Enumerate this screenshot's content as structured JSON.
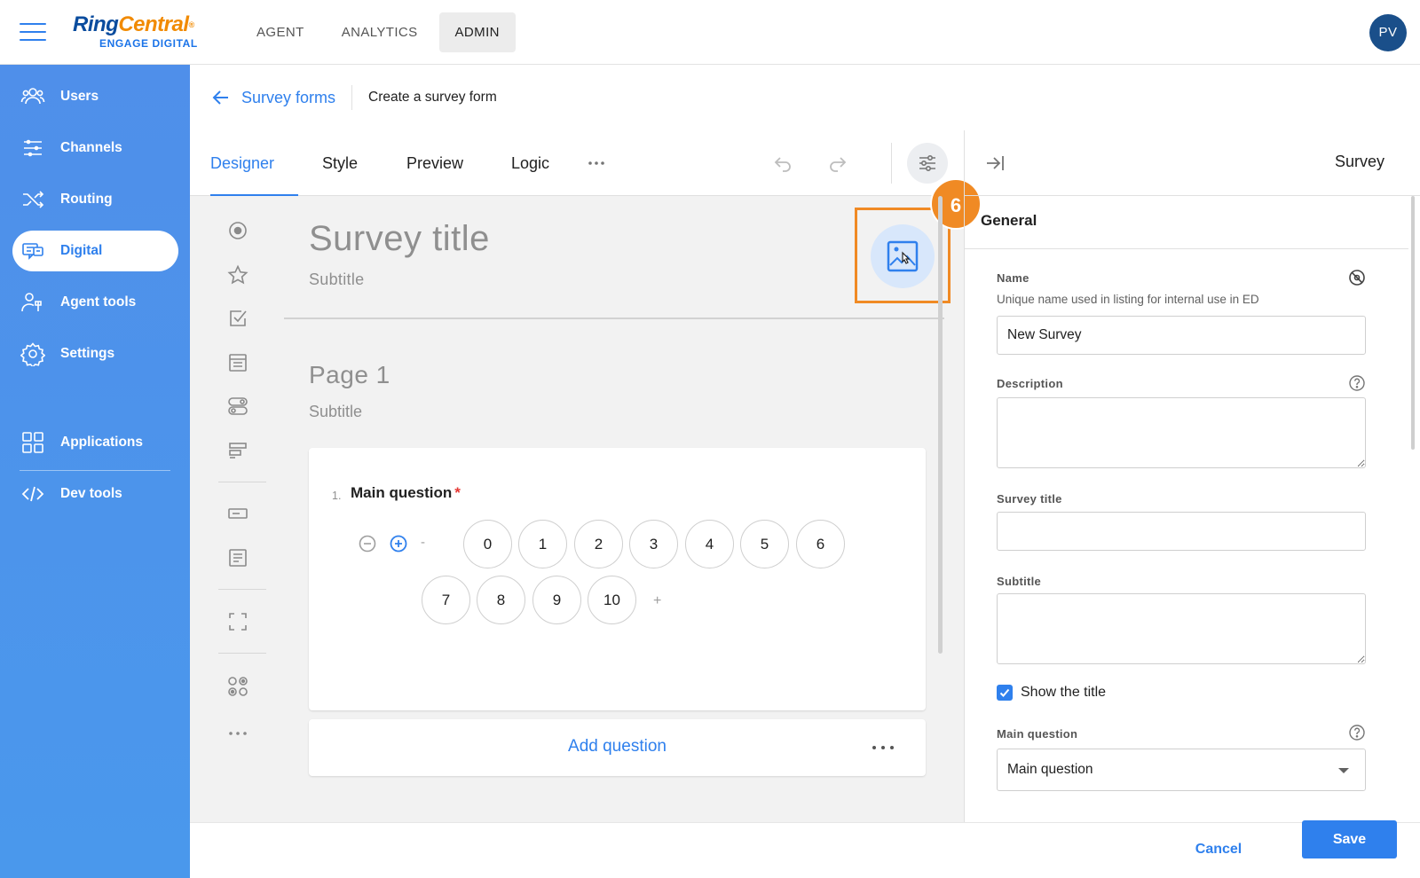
{
  "header": {
    "logo_brand_part1": "Ring",
    "logo_brand_part2": "Central",
    "logo_reg": "®",
    "logo_sub": "ENGAGE DIGITAL",
    "nav": [
      {
        "label": "AGENT",
        "active": false
      },
      {
        "label": "ANALYTICS",
        "active": false
      },
      {
        "label": "ADMIN",
        "active": true
      }
    ],
    "avatar_initials": "PV"
  },
  "sidebar": {
    "items": [
      {
        "label": "Users",
        "icon": "users-icon"
      },
      {
        "label": "Channels",
        "icon": "channels-icon"
      },
      {
        "label": "Routing",
        "icon": "routing-icon"
      },
      {
        "label": "Digital",
        "icon": "digital-icon",
        "active": true
      },
      {
        "label": "Agent tools",
        "icon": "agent-tools-icon"
      },
      {
        "label": "Settings",
        "icon": "gear-icon"
      },
      {
        "label": "Applications",
        "icon": "applications-icon"
      },
      {
        "label": "Dev tools",
        "icon": "code-icon"
      }
    ]
  },
  "breadcrumb": {
    "parent": "Survey forms",
    "current": "Create a survey form"
  },
  "tabs": [
    {
      "label": "Designer",
      "active": true
    },
    {
      "label": "Style"
    },
    {
      "label": "Preview"
    },
    {
      "label": "Logic"
    }
  ],
  "toolbar_icons": [
    "more-horizontal-icon",
    "undo-icon",
    "redo-icon",
    "settings-sliders-icon"
  ],
  "canvas": {
    "survey_title": "Survey title",
    "survey_subtitle": "Subtitle",
    "step_badge": "6",
    "page_title": "Page 1",
    "page_subtitle": "Subtitle",
    "question": {
      "number": "1.",
      "text": "Main question",
      "required_mark": "*",
      "min_placeholder": "-",
      "max_placeholder": "+",
      "rates": [
        "0",
        "1",
        "2",
        "3",
        "4",
        "5",
        "6",
        "7",
        "8",
        "9",
        "10"
      ]
    },
    "add_question_label": "Add question"
  },
  "panel": {
    "title": "Survey",
    "section": "General",
    "name_label": "Name",
    "name_hint": "Unique name used in listing for internal use in ED",
    "name_value": "New Survey",
    "description_label": "Description",
    "survey_title_label": "Survey title",
    "subtitle_label": "Subtitle",
    "show_title_label": "Show the title",
    "show_title_checked": true,
    "main_question_label": "Main question",
    "main_question_value": "Main question"
  },
  "footer": {
    "cancel_label": "Cancel",
    "save_label": "Save"
  },
  "colors": {
    "accent": "#2f80ed",
    "highlight": "#f08a24",
    "sidebar": "#4f8fea"
  }
}
